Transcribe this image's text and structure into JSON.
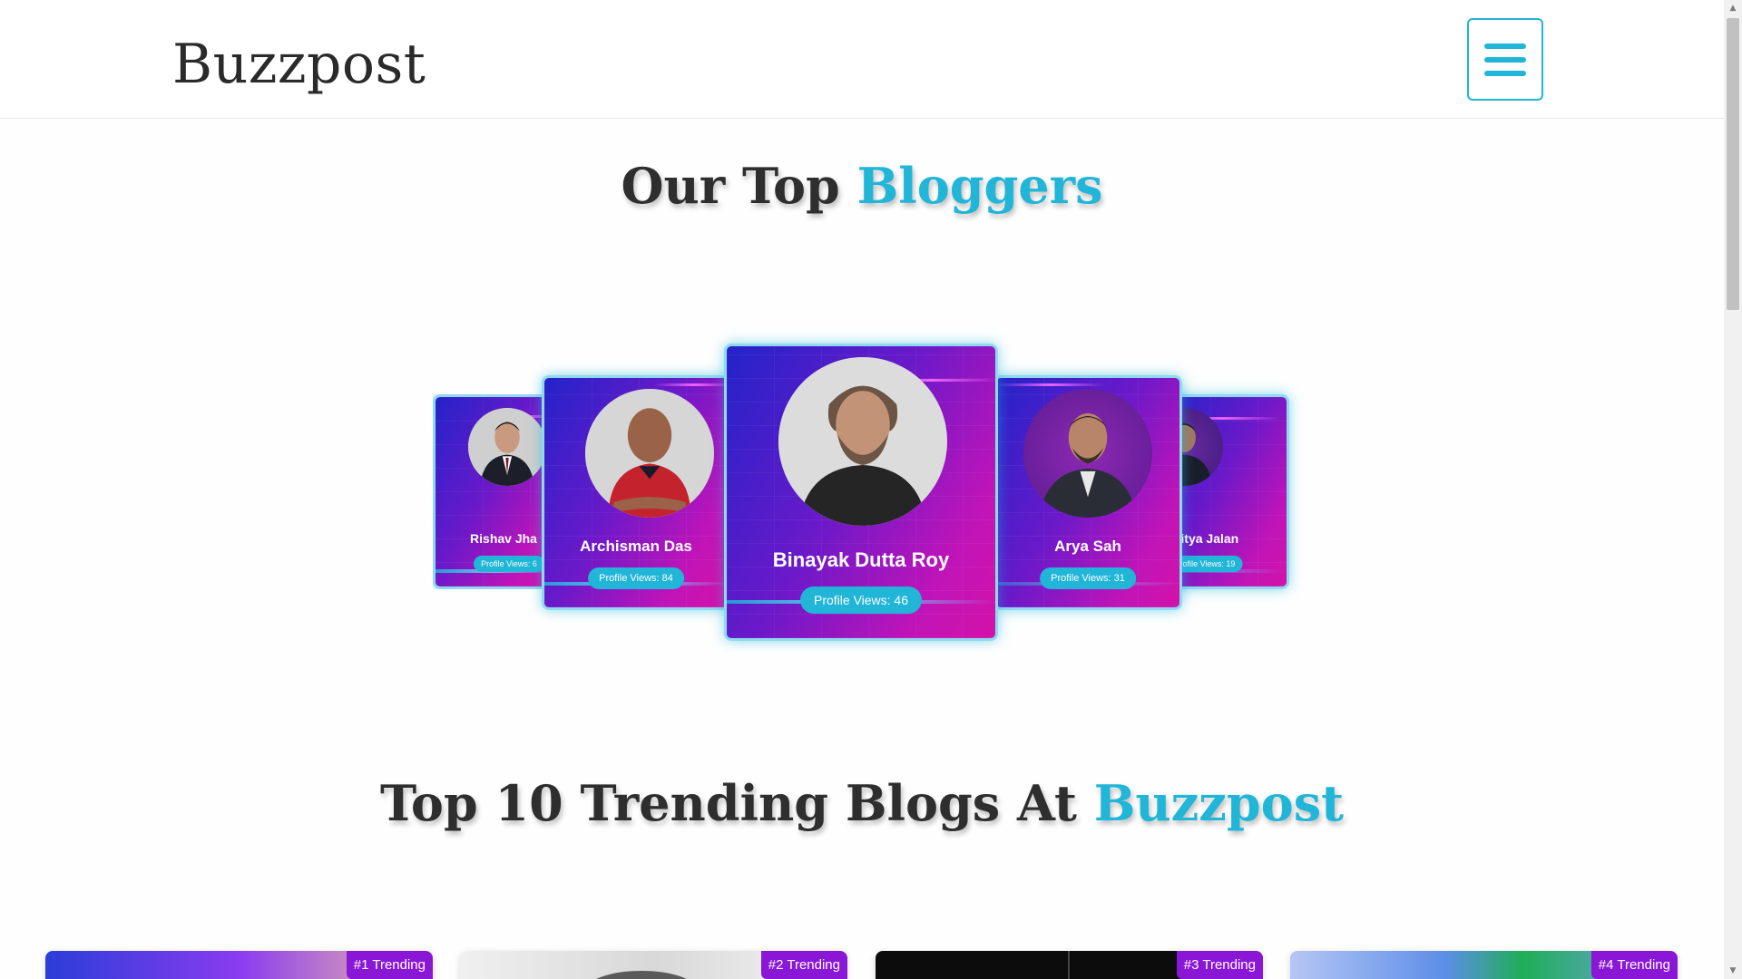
{
  "header": {
    "logo": "Buzzpost",
    "menu_icon": "hamburger-menu-icon"
  },
  "bloggers_section": {
    "title_part1": "Our Top ",
    "title_accent": "Bloggers"
  },
  "bloggers": [
    {
      "name": "Rishav Jha",
      "views_label": "Profile Views: 6",
      "position": "far-left"
    },
    {
      "name": "Archisman Das",
      "views_label": "Profile Views: 84",
      "position": "left"
    },
    {
      "name": "Binayak Dutta Roy",
      "views_label": "Profile Views: 46",
      "position": "center"
    },
    {
      "name": "Arya Sah",
      "views_label": "Profile Views: 31",
      "position": "right"
    },
    {
      "name": "Aditya Jalan",
      "views_label": "Profile Views: 19",
      "position": "far-right"
    }
  ],
  "trending_section": {
    "title_part1": "Top 10 Trending Blogs At ",
    "title_accent": "Buzzpost"
  },
  "trending_blogs": [
    {
      "badge": "#1 Trending"
    },
    {
      "badge": "#2 Trending"
    },
    {
      "badge": "#3 Trending"
    },
    {
      "badge": "#4 Trending"
    }
  ],
  "colors": {
    "accent": "#21b5d8",
    "badge": "#8a16d6",
    "card_gradient_start": "#2323c9",
    "card_gradient_end": "#d312a8"
  }
}
